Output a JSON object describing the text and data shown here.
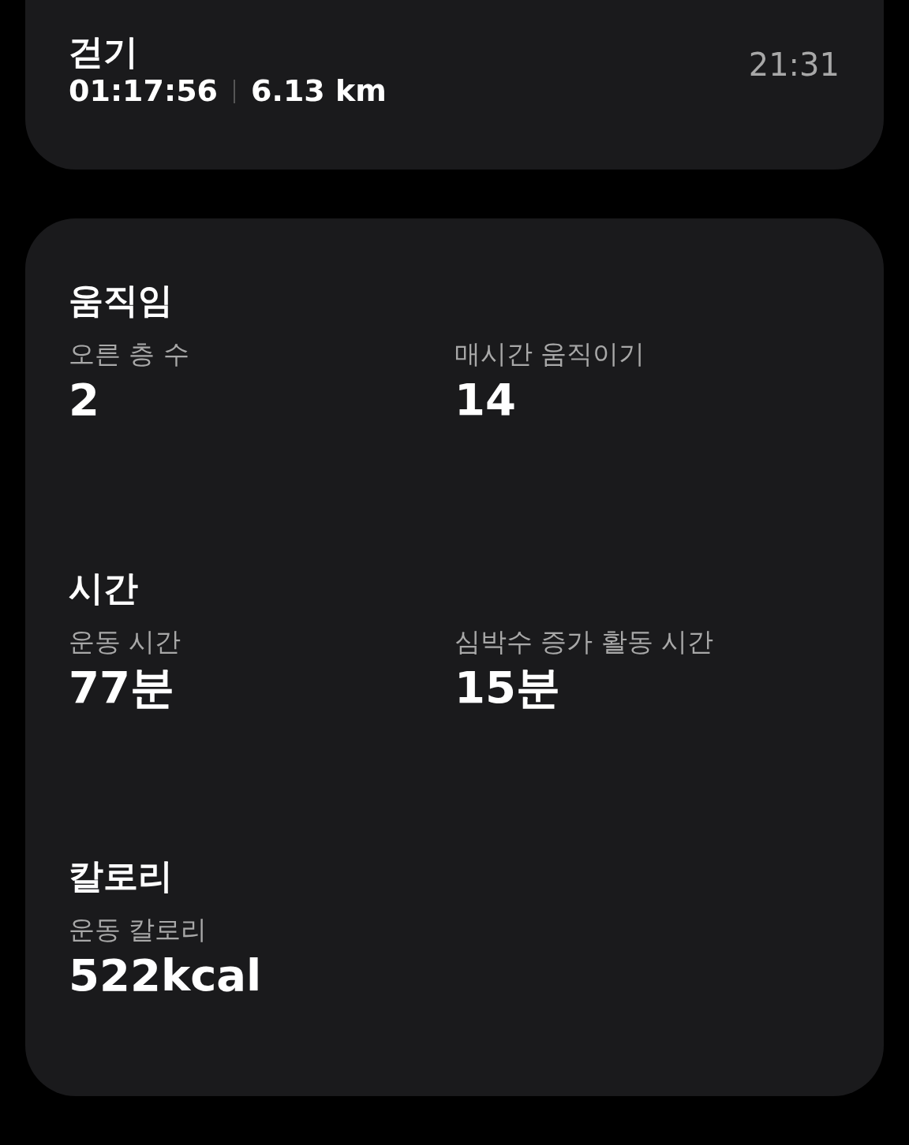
{
  "header": {
    "title": "걷기",
    "duration": "01:17:56",
    "distance": "6.13 km",
    "time": "21:31"
  },
  "sections": [
    {
      "title": "움직임",
      "stats": [
        {
          "label": "오른 층 수",
          "value": "2"
        },
        {
          "label": "매시간 움직이기",
          "value": "14"
        }
      ]
    },
    {
      "title": "시간",
      "stats": [
        {
          "label": "운동 시간",
          "value": "77분"
        },
        {
          "label": "심박수 증가 활동 시간",
          "value": "15분"
        }
      ]
    },
    {
      "title": "칼로리",
      "stats": [
        {
          "label": "운동 칼로리",
          "value": "522kcal"
        }
      ]
    }
  ]
}
